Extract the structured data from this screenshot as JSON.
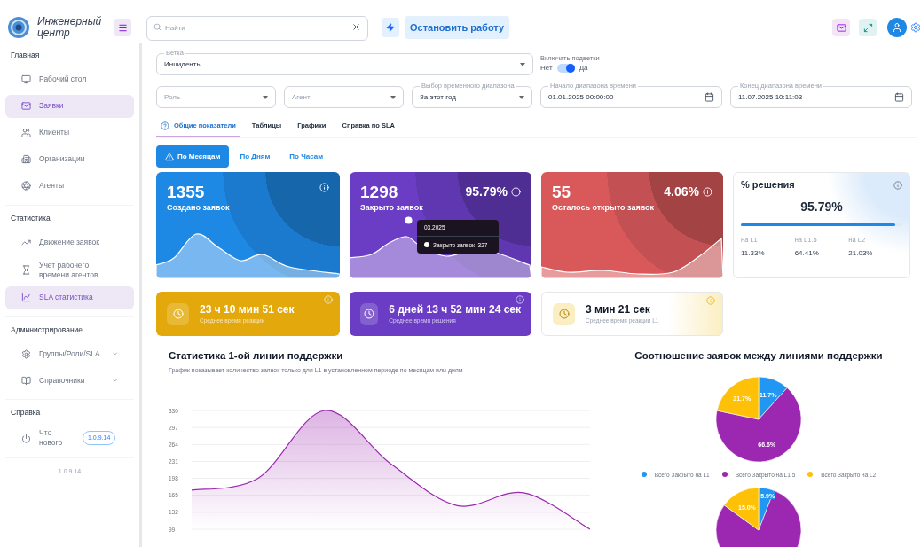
{
  "header": {
    "logo_text": "Инженерный центр",
    "search": {
      "placeholder": "Найти"
    },
    "stop_button": "Остановить работу"
  },
  "sidebar": {
    "sections": [
      {
        "title": "Главная",
        "items": [
          {
            "label": "Рабочий стол",
            "selected": false
          },
          {
            "label": "Заявки",
            "selected": true
          },
          {
            "label": "Клиенты",
            "selected": false
          },
          {
            "label": "Организации",
            "selected": false
          },
          {
            "label": "Агенты",
            "selected": false
          }
        ]
      },
      {
        "title": "Статистика",
        "items": [
          {
            "label": "Движение заявок",
            "selected": false
          },
          {
            "label": "Учет рабочего времени агентов",
            "selected": false
          },
          {
            "label": "SLA статистика",
            "selected": true
          }
        ]
      },
      {
        "title": "Администрирование",
        "items": [
          {
            "label": "Группы/Роли/SLA",
            "selected": false,
            "expandable": true
          },
          {
            "label": "Справочники",
            "selected": false,
            "expandable": true
          }
        ]
      },
      {
        "title": "Справка",
        "items": [
          {
            "label": "Что нового",
            "selected": false,
            "badge": "1.0.9.14"
          }
        ]
      }
    ],
    "version": "1.0.9.14"
  },
  "filters": {
    "branch": {
      "label": "Ветка",
      "value": "Инциденты"
    },
    "subbranches": {
      "label": "Включать подветки",
      "off_label": "Нет",
      "on_label": "Да",
      "on": true
    },
    "role": {
      "placeholder": "Роль"
    },
    "agent": {
      "placeholder": "Агент"
    },
    "range": {
      "label": "Выбор временного диапазона",
      "value": "За этот год"
    },
    "start": {
      "label": "Начало диапазона времени",
      "value": "01.01.2025 00:00:00"
    },
    "end": {
      "label": "Конец диапазона времени",
      "value": "11.07.2025 10:11:03"
    }
  },
  "tabs": [
    {
      "label": "Общие показатели",
      "selected": true
    },
    {
      "label": "Таблицы",
      "selected": false
    },
    {
      "label": "Графики",
      "selected": false
    },
    {
      "label": "Справка по SLA",
      "selected": false
    }
  ],
  "periods": [
    {
      "label": "По Месяцам",
      "selected": true
    },
    {
      "label": "По Дням",
      "selected": false
    },
    {
      "label": "По Часам",
      "selected": false
    }
  ],
  "kpi_cards": [
    {
      "value": "1355",
      "label": "Создано заявок",
      "color": "#1e88e5"
    },
    {
      "value": "1298",
      "label": "Закрыто заявок",
      "percent": "95.79%",
      "color": "#6a3dc4",
      "tooltip": {
        "title": "03.2025",
        "text": "Закрыто заявок  327"
      }
    },
    {
      "value": "55",
      "label": "Осталось открыто заявок",
      "percent": "4.06%",
      "color": "#d9595b"
    }
  ],
  "resolution": {
    "title": "% решения",
    "value": "95.79%",
    "level": 0.9579,
    "stats": [
      {
        "label": "на L1",
        "value": "11.33%"
      },
      {
        "label": "на L1.5",
        "value": "64.41%"
      },
      {
        "label": "на L2",
        "value": "21.03%"
      }
    ]
  },
  "time_cards": [
    {
      "kind": "filled",
      "value": "23 ч 10 мин 51 сек",
      "label": "Среднее время реакции",
      "color": "#e3a90c"
    },
    {
      "kind": "filled",
      "value": "6 дней 13 ч 52 мин 24 сек",
      "label": "Среднее время решения",
      "color": "#6a3dc4"
    },
    {
      "kind": "light",
      "value": "3 мин 21 сек",
      "label": "Среднее время реакции L1",
      "color": "#fbeec2"
    }
  ],
  "line_section": {
    "title": "Статистика 1-ой линии поддержки",
    "subtitle": "График показывает количество заявок только для L1 в установленном периоде по месяцам или дням",
    "chart_data": {
      "type": "area",
      "ylim": [
        99,
        330
      ],
      "yticks": [
        99,
        132,
        165,
        198,
        231,
        264,
        297,
        330
      ],
      "grid": true,
      "series": [
        {
          "color": "#9c27b0",
          "values": [
            175,
            198,
            330,
            226,
            145,
            170,
            99
          ]
        }
      ]
    }
  },
  "pie_section": {
    "title": "Соотношение заявок между линиями поддержки",
    "charts": [
      {
        "chart_data": {
          "type": "pie",
          "categories": [
            "Всего Закрыто на L1",
            "Всего Закрыто на L1.5",
            "Всего Закрыто на L2"
          ],
          "colors": [
            "#2196f3",
            "#9c27b0",
            "#ffc107"
          ],
          "values": [
            11.7,
            66.6,
            21.7
          ],
          "value_labels": [
            "11.7%",
            "66.6%",
            "21.7%"
          ]
        }
      },
      {
        "slice_labels": [
          "5.9%",
          "15.0%"
        ]
      }
    ]
  }
}
